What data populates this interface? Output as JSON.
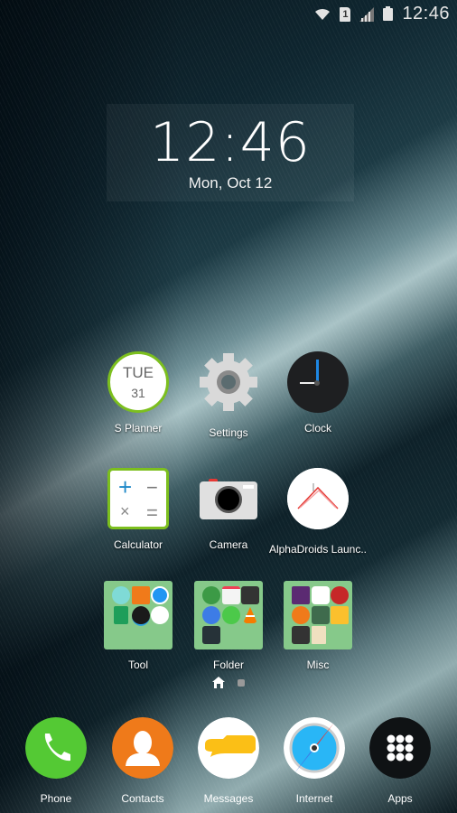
{
  "status_bar": {
    "time": "12:46",
    "sim_slot": "1",
    "icons": [
      "wifi-icon",
      "sim-icon",
      "signal-icon",
      "battery-icon"
    ]
  },
  "clock_widget": {
    "time": "12:46",
    "date": "Mon, Oct 12"
  },
  "apps": [
    {
      "label": "S Planner",
      "icon": "calendar-icon",
      "day": "TUE",
      "date": "31"
    },
    {
      "label": "Settings",
      "icon": "gear-icon"
    },
    {
      "label": "Clock",
      "icon": "clock-icon"
    },
    {
      "label": "Calculator",
      "icon": "calculator-icon",
      "symbols": [
        "+",
        "−",
        "×",
        "="
      ]
    },
    {
      "label": "Camera",
      "icon": "camera-icon"
    },
    {
      "label": "AlphaDroids Launc..",
      "icon": "alphadroids-icon"
    }
  ],
  "folders": [
    {
      "label": "Tool",
      "icons": [
        "c-app-icon",
        "bottle-icon",
        "compass-icon",
        "sheets-icon",
        "planet-icon",
        "smart-home-icon"
      ]
    },
    {
      "label": "Folder",
      "icons": [
        "map-pin-icon",
        "pocket-icon",
        "android-box-icon",
        "play-icon",
        "phone-icon",
        "vlc-icon",
        "wifi-icon"
      ]
    },
    {
      "label": "Misc",
      "icons": [
        "josh-icon",
        "target-icon",
        "bird-icon",
        "head-icon",
        "flame-icon",
        "bulb-icon",
        "android-box-icon",
        "word-icon"
      ]
    }
  ],
  "page_indicator": {
    "pages": 2,
    "current": "home"
  },
  "dock": [
    {
      "label": "Phone",
      "icon": "phone-icon",
      "color": "#54c934"
    },
    {
      "label": "Contacts",
      "icon": "contact-icon",
      "color": "#ef7a1a"
    },
    {
      "label": "Messages",
      "icon": "messages-icon",
      "color": "#ffffff"
    },
    {
      "label": "Internet",
      "icon": "compass-icon",
      "color": "#ffffff"
    },
    {
      "label": "Apps",
      "icon": "apps-grid-icon",
      "color": "#0f1214"
    }
  ]
}
